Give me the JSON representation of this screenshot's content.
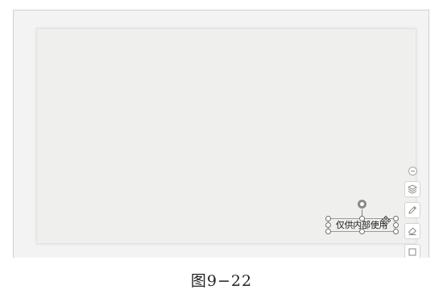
{
  "canvas": {
    "textbox": {
      "text": "仅供内部使用"
    }
  },
  "toolbar": {
    "items": [
      {
        "icon": "zoom-out-icon"
      },
      {
        "icon": "layers-icon"
      },
      {
        "icon": "pen-icon"
      },
      {
        "icon": "eraser-icon"
      },
      {
        "icon": "square-icon"
      }
    ]
  },
  "caption": "图9−22"
}
